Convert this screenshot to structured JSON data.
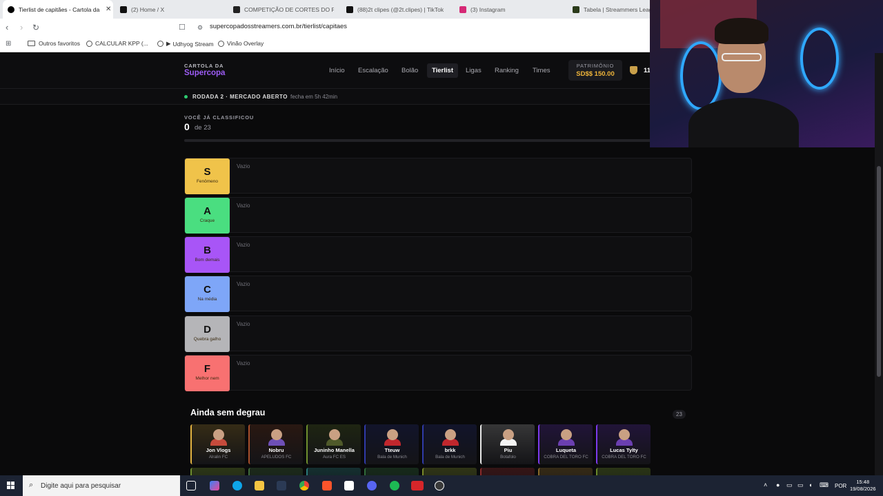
{
  "browser": {
    "tabs": [
      {
        "title": "Tierlist de capitães - Cartola da S",
        "color": "#000000",
        "active": true
      },
      {
        "title": "(2) Home / X",
        "color": "#111111"
      },
      {
        "title": "COMPETIÇÃO DE CORTES DO PATRÃ",
        "color": "#222222"
      },
      {
        "title": "(88)2t clipes (@2t.clipes) | TikTok",
        "color": "#111111"
      },
      {
        "title": "(3) Instagram",
        "color": "#d62976"
      },
      {
        "title": "Tabela | Streammers League",
        "color": "#2b3b1b"
      }
    ],
    "url": "supercopadosstreamers.com.br/tierlist/capitaes",
    "bookmarks": [
      "Outros favoritos",
      "CALCULAR KPP (...",
      "Udhyog Stream",
      "Vinão Overlay"
    ]
  },
  "site": {
    "brand_small": "CARTOLA DA",
    "brand_big": "Supercopa",
    "menu": [
      "Início",
      "Escalação",
      "Bolão",
      "Tierlist",
      "Ligas",
      "Ranking",
      "Times"
    ],
    "active_menu": "Tierlist",
    "patrimonio_label": "PATRIMÔNIO",
    "patrimonio_value": "SD$$ 150.00",
    "profile_text": "11",
    "round_label": "RODADA 2 · MERCADO ABERTO",
    "round_close": "fecha em 5h 42min",
    "classified_label": "VOCÊ JÁ CLASSIFICOU",
    "classified_count": "0",
    "classified_of": "de 23",
    "progress_fraction": 0,
    "tiers": [
      {
        "letter": "S",
        "name": "Fenômeno",
        "color": "#f0c34a",
        "empty": "Vazio"
      },
      {
        "letter": "A",
        "name": "Craque",
        "color": "#4ade80",
        "empty": "Vazio"
      },
      {
        "letter": "B",
        "name": "Bom demais",
        "color": "#a855f7",
        "empty": "Vazio"
      },
      {
        "letter": "C",
        "name": "Na média",
        "color": "#7ea6f8",
        "empty": "Vazio"
      },
      {
        "letter": "D",
        "name": "Quebra galho",
        "color": "#b5b5b8",
        "empty": "Vazio"
      },
      {
        "letter": "F",
        "name": "Melhor nem",
        "color": "#f87171",
        "empty": "Vazio"
      }
    ],
    "unranked_title": "Ainda sem degrau",
    "unranked_count": "23",
    "players": [
      {
        "name": "Jon Vlogs",
        "team": "Alralin FC",
        "accent": "#e3b341",
        "shirt": "#c64b3c"
      },
      {
        "name": "Nobru",
        "team": "APELUDOS FC",
        "accent": "#a74f2b",
        "shirt": "#6e4fb6"
      },
      {
        "name": "Juninho Manella",
        "team": "Aura FC ES",
        "accent": "#6f8f2e",
        "shirt": "#4f5a2a"
      },
      {
        "name": "Tteuw",
        "team": "Bala de Munich",
        "accent": "#2f3aa8",
        "shirt": "#c0272d"
      },
      {
        "name": "brkk",
        "team": "Bala de Munich",
        "accent": "#2f3aa8",
        "shirt": "#c0272d"
      },
      {
        "name": "Piu",
        "team": "Botafolo",
        "accent": "#e8e8e8",
        "shirt": "#f4f4f4"
      },
      {
        "name": "Luqueta",
        "team": "COBRA DEL TORO FC",
        "accent": "#7c3aed",
        "shirt": "#6b3fb0"
      },
      {
        "name": "Lucas Tylty",
        "team": "COBRA DEL TORO FC",
        "accent": "#7c3aed",
        "shirt": "#6b3fb0"
      }
    ]
  },
  "taskbar": {
    "search_placeholder": "Digite aqui para pesquisar",
    "lang": "POR",
    "time": "15:48",
    "date": "19/08/2026"
  }
}
